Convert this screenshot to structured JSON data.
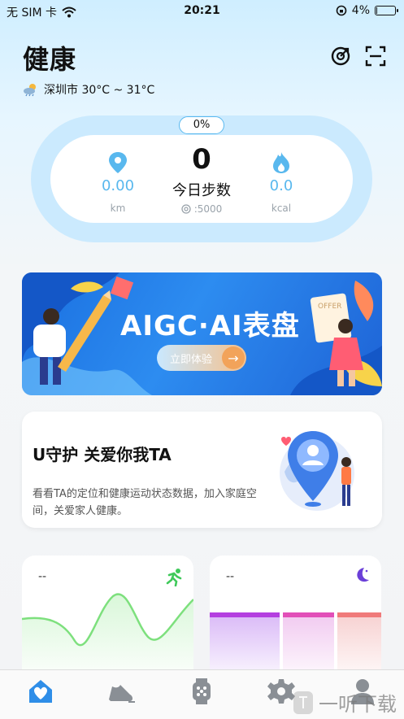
{
  "status_bar": {
    "carrier": "无 SIM 卡",
    "time": "20:21",
    "battery": "4%",
    "battery_level": 0.04
  },
  "header": {
    "title": "健康",
    "weather": "深圳市 30°C ~ 31°C"
  },
  "steps_card": {
    "progress": "0%",
    "distance_value": "0.00",
    "distance_unit": "km",
    "steps_value": "0",
    "steps_label": "今日步数",
    "goal": ":5000",
    "calories_value": "0.0",
    "calories_unit": "kcal"
  },
  "banner": {
    "title": "AIGC·AI表盘",
    "button": "立即体验",
    "sign_text": "OFFER"
  },
  "guard_card": {
    "title": "U守护 关爱你我TA",
    "description": "看看TA的定位和健康运动状态数据，加入家庭空间，关爱家人健康。"
  },
  "exercise_card": {
    "value": "--"
  },
  "sleep_card": {
    "value": "--"
  },
  "tabs": [
    "home",
    "sport",
    "device",
    "settings",
    "profile"
  ],
  "watermark": "一听下载",
  "colors": {
    "accent": "#59b8ee",
    "tab_active": "#2f8ee8",
    "chart_line": "#7de07d",
    "sleep_purple": "#b43fe0",
    "sleep_pink": "#e24fb8",
    "sleep_red": "#f07a7a"
  }
}
